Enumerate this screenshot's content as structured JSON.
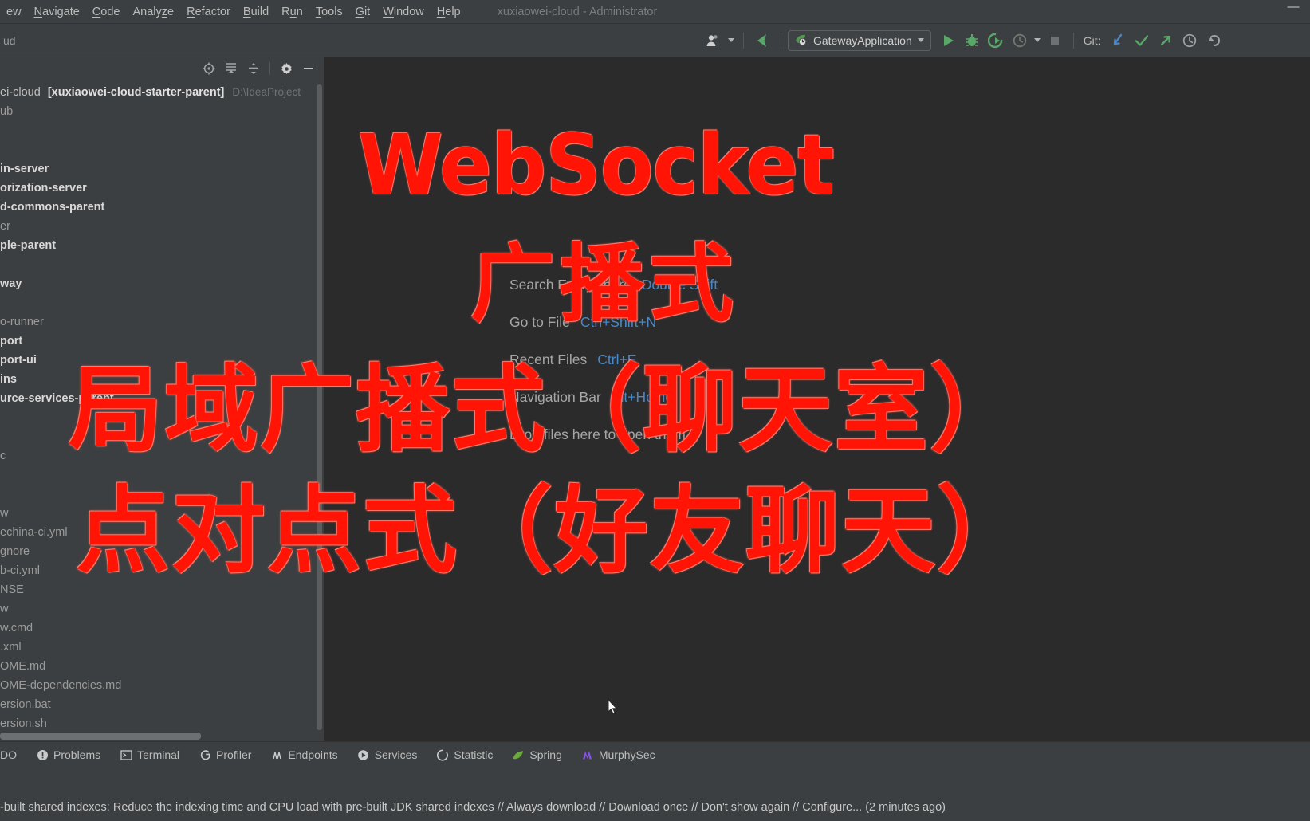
{
  "window": {
    "title": "xuxiaowei-cloud - Administrator",
    "minimize_label": "—"
  },
  "menubar": {
    "items": [
      {
        "label": "ew",
        "mnemonic": ""
      },
      {
        "label": "Navigate",
        "mnemonic": "N"
      },
      {
        "label": "Code",
        "mnemonic": "C"
      },
      {
        "label": "Analyze",
        "mnemonic": "z"
      },
      {
        "label": "Refactor",
        "mnemonic": "R"
      },
      {
        "label": "Build",
        "mnemonic": "B"
      },
      {
        "label": "Run",
        "mnemonic": "u"
      },
      {
        "label": "Tools",
        "mnemonic": "T"
      },
      {
        "label": "Git",
        "mnemonic": "G"
      },
      {
        "label": "Window",
        "mnemonic": "W"
      },
      {
        "label": "Help",
        "mnemonic": "H"
      }
    ]
  },
  "toolbar": {
    "left_text": "ud",
    "run_configuration": "GatewayApplication",
    "git_label": "Git:",
    "icons": [
      "user-settings-icon",
      "back-arrow-icon",
      "run-icon",
      "debug-icon",
      "run-with-coverage-icon",
      "profile-icon",
      "stop-icon",
      "update-project-icon",
      "commit-icon",
      "push-icon",
      "history-icon",
      "rollback-icon"
    ],
    "accent_green": "#59a869",
    "accent_blue": "#4a88c7"
  },
  "sidebar": {
    "toolbar_icons": [
      "select-opened-file-icon",
      "expand-all-icon",
      "collapse-all-icon",
      "settings-gear-icon",
      "hide-icon"
    ],
    "tree": [
      {
        "label": "ei-cloud",
        "bold_part": "[xuxiaowei-cloud-starter-parent]",
        "path": "D:\\IdeaProject",
        "style": "root"
      },
      {
        "label": "ub",
        "style": "dim"
      },
      {
        "label": "",
        "style": "blank"
      },
      {
        "label": "",
        "style": "blank"
      },
      {
        "label": "in-server",
        "style": "bold"
      },
      {
        "label": "orization-server",
        "style": "bold"
      },
      {
        "label": "d-commons-parent",
        "style": "bold"
      },
      {
        "label": "er",
        "style": "dim"
      },
      {
        "label": "ple-parent",
        "style": "bold"
      },
      {
        "label": "",
        "style": "blank"
      },
      {
        "label": "way",
        "style": "bold"
      },
      {
        "label": "",
        "style": "blank"
      },
      {
        "label": "o-runner",
        "style": "dim"
      },
      {
        "label": "port",
        "style": "bold"
      },
      {
        "label": "port-ui",
        "style": "bold"
      },
      {
        "label": "ins",
        "style": "bold"
      },
      {
        "label": "urce-services-parent",
        "style": "bold"
      },
      {
        "label": "",
        "style": "blank"
      },
      {
        "label": "",
        "style": "blank"
      },
      {
        "label": "c",
        "style": "dim"
      },
      {
        "label": "",
        "style": "blank"
      },
      {
        "label": "",
        "style": "blank"
      },
      {
        "label": "w",
        "style": "dim"
      },
      {
        "label": "echina-ci.yml",
        "style": "dim"
      },
      {
        "label": "gnore",
        "style": "dim"
      },
      {
        "label": "b-ci.yml",
        "style": "dim"
      },
      {
        "label": "NSE",
        "style": "dim"
      },
      {
        "label": "w",
        "style": "dim"
      },
      {
        "label": "w.cmd",
        "style": "dim"
      },
      {
        "label": ".xml",
        "style": "dim"
      },
      {
        "label": "OME.md",
        "style": "dim"
      },
      {
        "label": "OME-dependencies.md",
        "style": "dim"
      },
      {
        "label": "ersion.bat",
        "style": "dim"
      },
      {
        "label": "ersion.sh",
        "style": "dim"
      }
    ]
  },
  "editor": {
    "hints": [
      {
        "label": "Search Everywhere",
        "key": "Double Shift"
      },
      {
        "label": "Go to File",
        "key": "Ctrl+Shift+N"
      },
      {
        "label": "Recent Files",
        "key": "Ctrl+E"
      },
      {
        "label": "Navigation Bar",
        "key": "Alt+Home"
      },
      {
        "label": "Drop files here to open them",
        "key": ""
      }
    ]
  },
  "overlay": {
    "color": "#ff1405",
    "lines": [
      "WebSocket",
      "广播式",
      "局域广播式（聊天室）",
      "点对点式（好友聊天）"
    ]
  },
  "bottom_bar": {
    "items": [
      {
        "label": "DO",
        "icon": "todo-icon"
      },
      {
        "label": "Problems",
        "icon": "problems-icon"
      },
      {
        "label": "Terminal",
        "icon": "terminal-icon"
      },
      {
        "label": "Profiler",
        "icon": "profiler-icon"
      },
      {
        "label": "Endpoints",
        "icon": "endpoints-icon"
      },
      {
        "label": "Services",
        "icon": "services-icon"
      },
      {
        "label": "Statistic",
        "icon": "statistic-icon"
      },
      {
        "label": "Spring",
        "icon": "spring-leaf-icon"
      },
      {
        "label": "MurphySec",
        "icon": "murphysec-icon"
      }
    ]
  },
  "status_bar": {
    "message": "-built shared indexes: Reduce the indexing time and CPU load with pre-built JDK shared indexes // Always download // Download once // Don't show again // Configure... (2 minutes ago)"
  }
}
